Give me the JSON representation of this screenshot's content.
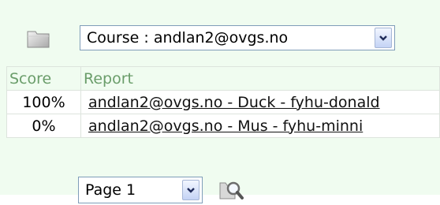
{
  "toolbar": {
    "folder_icon": "folder-icon",
    "course_select": {
      "selected": "Course : andlan2@ovgs.no"
    }
  },
  "table": {
    "headers": {
      "score": "Score",
      "report": "Report"
    },
    "rows": [
      {
        "score": "100%",
        "report": "andlan2@ovgs.no - Duck - fyhu-donald"
      },
      {
        "score": "0%",
        "report": "andlan2@ovgs.no - Mus - fyhu-minni"
      }
    ]
  },
  "pager": {
    "selected": "Page 1",
    "search_icon": "magnifier-icon"
  }
}
